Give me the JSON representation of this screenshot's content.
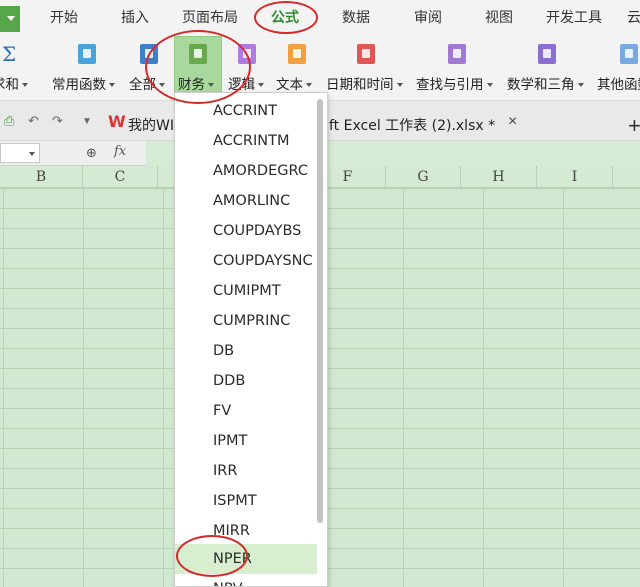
{
  "menu": {
    "tabs": [
      "开始",
      "插入",
      "页面布局",
      "公式",
      "数据",
      "审阅",
      "视图",
      "开发工具",
      "云"
    ]
  },
  "ribbon": {
    "groups": [
      "求和",
      "常用函数",
      "全部",
      "财务",
      "逻辑",
      "文本",
      "日期和时间",
      "查找与引用",
      "数学和三角",
      "其他函数"
    ],
    "icon_colors": [
      "#2f6fb8",
      "#4aa3d8",
      "#3f7fc8",
      "#6aa84f",
      "#b07be0",
      "#f0a040",
      "#e05656",
      "#a07ad0",
      "#8a6fd0",
      "#7aa8e0"
    ]
  },
  "doc": {
    "title_part1": "我的WI",
    "title_part2": "ft Excel 工作表 (2).xlsx *",
    "close": "×",
    "new_tab": "+"
  },
  "formula_bar": {
    "fx": "fx"
  },
  "columns": [
    "B",
    "C",
    "",
    "E",
    "F",
    "G",
    "H",
    "I"
  ],
  "dropdown": {
    "items": [
      "ACCRINT",
      "ACCRINTM",
      "AMORDEGRC",
      "AMORLINC",
      "COUPDAYBS",
      "COUPDAYSNC",
      "CUMIPMT",
      "CUMPRINC",
      "DB",
      "DDB",
      "FV",
      "IPMT",
      "IRR",
      "ISPMT",
      "MIRR",
      "NPER",
      "NPV"
    ],
    "highlighted": "NPER"
  }
}
